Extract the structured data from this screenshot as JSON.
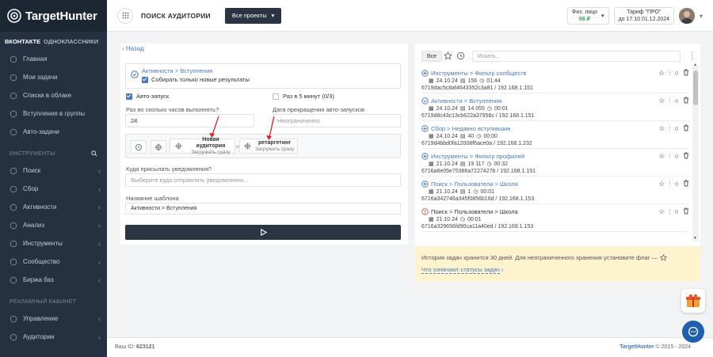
{
  "app": {
    "brand": "TargetHunter",
    "page_title": "ПОИСК АУДИТОРИИ",
    "projects_button": "Все проекты"
  },
  "account": {
    "type": "Физ. лицо",
    "balance": "98 ₽",
    "tariff": "Тариф \"ПРО\"",
    "tariff_until": "до 17:10 01.12.2024"
  },
  "sidebar": {
    "tabs": [
      "ВКОНТАКТЕ",
      "ОДНОКЛАССНИКИ"
    ],
    "main_items": [
      {
        "label": "Главная",
        "icon": "home-icon"
      },
      {
        "label": "Мои задачи",
        "icon": "tasks-icon"
      },
      {
        "label": "Списки в облаке",
        "icon": "cloud-icon"
      },
      {
        "label": "Вступления в группы",
        "icon": "group-join-icon"
      },
      {
        "label": "Авто-задачи",
        "icon": "auto-tasks-icon"
      }
    ],
    "tools_section": "ИНСТРУМЕНТЫ",
    "tool_items": [
      {
        "label": "Поиск",
        "icon": "search-icon"
      },
      {
        "label": "Сбор",
        "icon": "collect-icon"
      },
      {
        "label": "Активности",
        "icon": "heart-icon"
      },
      {
        "label": "Анализ",
        "icon": "chart-icon"
      },
      {
        "label": "Инструменты",
        "icon": "tools-icon"
      },
      {
        "label": "Сообщество",
        "icon": "community-icon"
      },
      {
        "label": "Биржа баз",
        "icon": "exchange-icon"
      }
    ],
    "ads_section": "РЕКЛАМНЫЙ КАБИНЕТ",
    "ads_items": [
      {
        "label": "Управление",
        "icon": "manage-icon"
      },
      {
        "label": "Аудитории",
        "icon": "audience-icon"
      }
    ]
  },
  "form": {
    "back": "Назад",
    "task_path": "Активности > Вступления",
    "only_new_label": "Собирать только новые результаты",
    "autostart_label": "Авто-запуск",
    "every5_label": "Раз в 5 минут (0/3)",
    "hours_label": "Раз во сколько часов выполнять?",
    "hours_value": "24",
    "stop_label": "Дата прекращения авто-запусков",
    "stop_placeholder": "Неограниченно",
    "or_text": "или",
    "new_aud_title": "Новая аудитория",
    "new_aud_sub": "Загружать сразу",
    "retarget_title": "ретаргетинг",
    "retarget_sub": "Загружать сразу",
    "notify_label": "Куда присылать уведомления?",
    "notify_placeholder": "Выберите куда отправлять уведомления...",
    "template_label": "Название шаблона",
    "template_value": "Активности > Вступления"
  },
  "history": {
    "all_button": "Все",
    "search_placeholder": "Искать...",
    "rows": [
      {
        "status": "ok",
        "path": "Инструменты > Фильтр сообществ",
        "date": "24.10.24",
        "count": "156",
        "time": "01:44",
        "id": "6719dac5c8af4643352c3a81 / 192.168.1.151"
      },
      {
        "status": "done",
        "path": "Активности > Вступления",
        "date": "24.10.24",
        "count": "14 055",
        "time": "00:01",
        "id": "6719d8c43c13cb622a37956c / 192.168.1.151"
      },
      {
        "status": "ok",
        "path": "Сбор > Недавно вступившие",
        "date": "24.10.24",
        "count": "40",
        "time": "00:00",
        "id": "6719d4bbd0fa12008f6ace0a / 192.168.1.232"
      },
      {
        "status": "ok",
        "path": "Инструменты > Фильтр профилей",
        "date": "21.10.24",
        "count": "19 117",
        "time": "00:32",
        "id": "6716a6e05e75386a7227427b / 192.168.1.151"
      },
      {
        "status": "ok",
        "path": "Поиск > Пользователи > Школа",
        "date": "21.10.24",
        "count": "1",
        "time": "00:01",
        "id": "6716a342746a345f0856b16d / 192.168.1.153"
      },
      {
        "status": "error",
        "path": "Поиск > Пользователи > Школа",
        "date": "21.10.24",
        "count": "",
        "time": "00:01",
        "id": "6716a329656fd90ca11a40ed / 192.168.1.153"
      }
    ],
    "notice": "История задач хранится 30 дней. Для неограниченного хранения установите флаг —",
    "statuses_link": "Что означают статусы задач"
  },
  "footer": {
    "user_id_label": "Ваш ID:",
    "user_id": "623121",
    "brand": "TargetHunter",
    "copyright": "© 2015 - 2024"
  },
  "colors": {
    "accent": "#4a78b8",
    "dark": "#2a3442",
    "sidebar": "#253040",
    "error": "#d9534f",
    "notice_bg": "#fdf3cf"
  }
}
